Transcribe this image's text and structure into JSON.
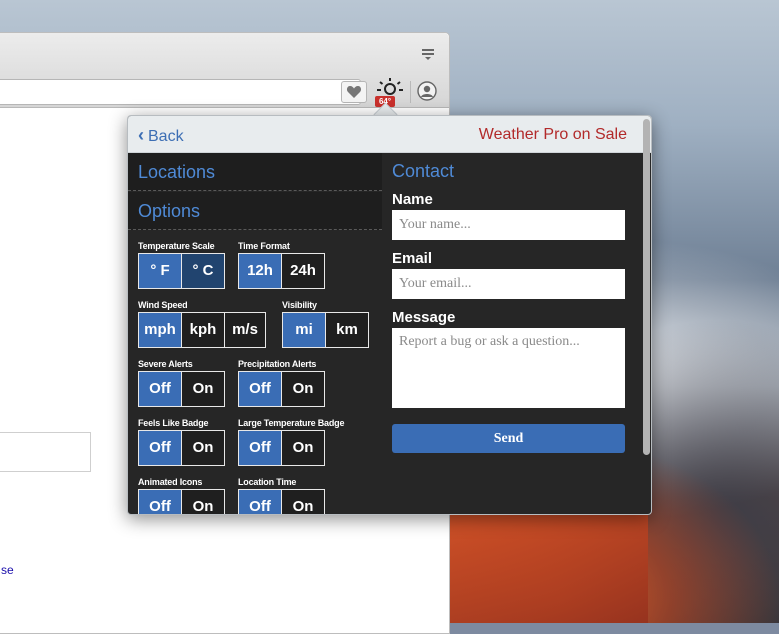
{
  "browser": {
    "link_text": "se",
    "badge_temp": "64°",
    "icons": [
      "menu-icon",
      "heart-icon",
      "weather-icon",
      "profile-icon"
    ]
  },
  "popup": {
    "back_label": "Back",
    "promo_label": "Weather Pro on Sale",
    "nav": {
      "locations": "Locations",
      "options": "Options"
    },
    "options": {
      "temperature_scale": {
        "label": "Temperature Scale",
        "values": [
          "° F",
          "° C"
        ],
        "selected": "° F"
      },
      "time_format": {
        "label": "Time Format",
        "values": [
          "12h",
          "24h"
        ],
        "selected": "12h"
      },
      "wind_speed": {
        "label": "Wind Speed",
        "values": [
          "mph",
          "kph",
          "m/s"
        ],
        "selected": "mph"
      },
      "visibility": {
        "label": "Visibility",
        "values": [
          "mi",
          "km"
        ],
        "selected": "mi"
      },
      "severe_alerts": {
        "label": "Severe Alerts",
        "values": [
          "Off",
          "On"
        ],
        "selected": "Off"
      },
      "precipitation_alerts": {
        "label": "Precipitation Alerts",
        "values": [
          "Off",
          "On"
        ],
        "selected": "Off"
      },
      "feels_like_badge": {
        "label": "Feels Like Badge",
        "values": [
          "Off",
          "On"
        ],
        "selected": "Off"
      },
      "large_temperature_badge": {
        "label": "Large Temperature Badge",
        "values": [
          "Off",
          "On"
        ],
        "selected": "Off"
      },
      "animated_icons": {
        "label": "Animated Icons",
        "values": [
          "Off",
          "On"
        ],
        "selected": "Off"
      },
      "location_time": {
        "label": "Location Time",
        "values": [
          "Off",
          "On"
        ],
        "selected": "Off"
      }
    },
    "contact": {
      "title": "Contact",
      "name_label": "Name",
      "name_placeholder": "Your name...",
      "email_label": "Email",
      "email_placeholder": "Your email...",
      "message_label": "Message",
      "message_placeholder": "Report a bug or ask a question...",
      "send_label": "Send"
    }
  },
  "colors": {
    "accent": "#3a6db5",
    "link_blue": "#4f8ad6",
    "promo_red": "#b22a2a",
    "panel_bg": "#262626",
    "header_bg": "#e8ecee"
  }
}
